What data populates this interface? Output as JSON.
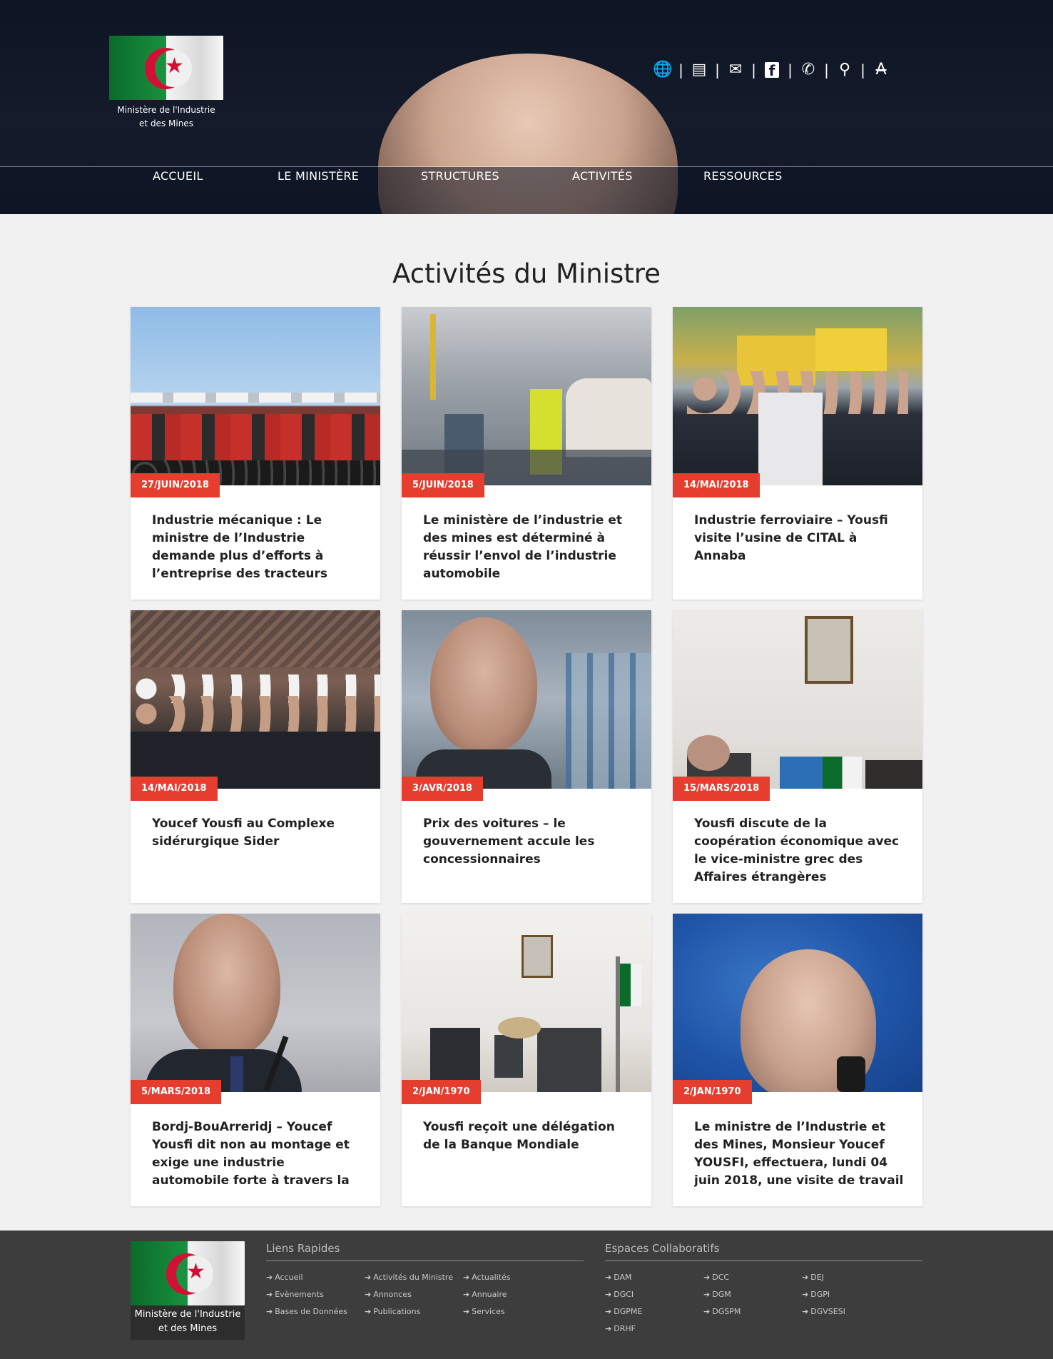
{
  "header": {
    "logo_text_line1": "Ministère de l'Industrie",
    "logo_text_line2": "et des Mines",
    "toolbar": [
      {
        "icon": "globe-icon",
        "glyph": "🌐"
      },
      {
        "icon": "book-icon",
        "glyph": "▤"
      },
      {
        "icon": "envelope-icon",
        "glyph": "✉"
      },
      {
        "icon": "facebook-icon",
        "glyph": "f"
      },
      {
        "icon": "phone-icon",
        "glyph": "✆"
      },
      {
        "icon": "search-icon",
        "glyph": "⚲"
      },
      {
        "icon": "font-size-icon",
        "glyph": "A"
      }
    ],
    "nav": [
      "ACCUEIL",
      "LE MINISTÈRE",
      "STRUCTURES",
      "ACTIVITÉS",
      "RESSOURCES"
    ]
  },
  "main": {
    "title": "Activités du Ministre",
    "cards": [
      {
        "date": "27/JUIN/2018",
        "title": "Industrie mécanique : Le ministre de l’Industrie demande plus d’efforts à l’entreprise des tracteurs agricoles"
      },
      {
        "date": "5/JUIN/2018",
        "title": "Le ministère de l’industrie et des mines est déterminé à réussir l’envol de l’industrie automobile"
      },
      {
        "date": "14/MAI/2018",
        "title": "Industrie ferroviaire – Yousfi visite l’usine de CITAL à Annaba"
      },
      {
        "date": "14/MAI/2018",
        "title": "Youcef Yousfi au Complexe sidérurgique Sider"
      },
      {
        "date": "3/AVR/2018",
        "title": "Prix des voitures – le gouvernement accule les concessionnaires"
      },
      {
        "date": "15/MARS/2018",
        "title": "Yousfi discute de la coopération économique avec le vice-ministre grec des Affaires étrangères"
      },
      {
        "date": "5/MARS/2018",
        "title": "Bordj-BouArreridj – Youcef Yousfi dit non au montage et exige une industrie automobile forte à travers la sous-traitance"
      },
      {
        "date": "2/JAN/1970",
        "title": "Yousfi reçoit une délégation de la Banque Mondiale"
      },
      {
        "date": "2/JAN/1970",
        "title": "Le ministre de l’Industrie et des Mines, Monsieur Youcef YOUSFI, effectuera, lundi 04 juin 2018, une visite de travail à la"
      }
    ]
  },
  "footer": {
    "logo_text_line1": "Ministère de l'Industrie",
    "logo_text_line2": "et des Mines",
    "quick_links_heading": "Liens Rapides",
    "quick_links": [
      "Accueil",
      "Activités du Ministre",
      "Actualités",
      "Evènements",
      "Annonces",
      "Annuaire",
      "Bases de Données",
      "Publications",
      "Services"
    ],
    "collab_heading": "Espaces Collaboratifs",
    "collab_links": [
      "DAM",
      "DCC",
      "DEJ",
      "DGCI",
      "DGM",
      "DGPI",
      "DGPME",
      "DGSPM",
      "DGVSESI",
      "DRHF"
    ]
  },
  "colors": {
    "accent": "#e53e2f",
    "header_bg": "#111827",
    "footer_bg": "#3d3d3d",
    "page_bg": "#f1f1f1"
  }
}
